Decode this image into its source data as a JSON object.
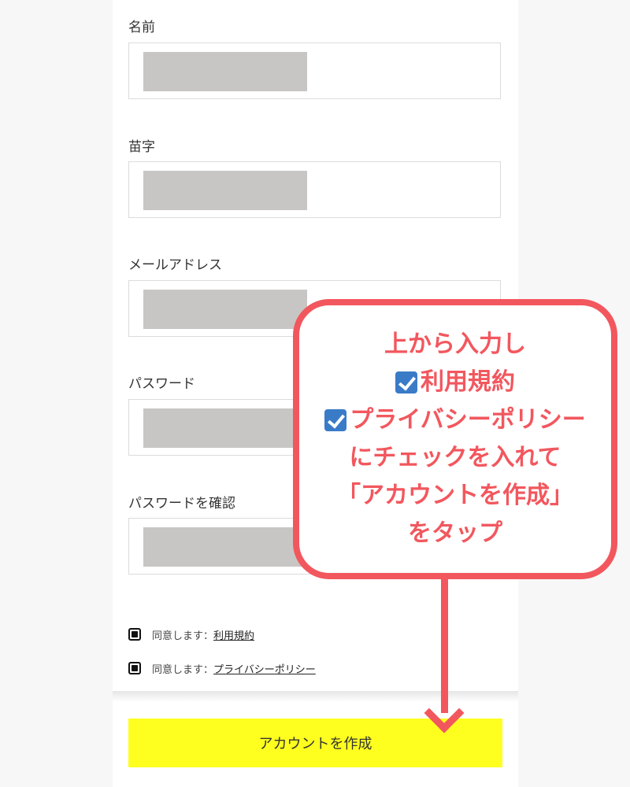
{
  "form": {
    "first_name_label": "名前",
    "last_name_label": "苗字",
    "email_label": "メールアドレス",
    "password_label": "パスワード",
    "confirm_password_label": "パスワードを確認",
    "agree_prefix": "同意します：",
    "terms_link": "利用規約",
    "privacy_link": "プライバシーポリシー",
    "create_button": "アカウントを作成"
  },
  "annotation": {
    "line1": "上から入力し",
    "line2": "利用規約",
    "line3": "プライバシーポリシー",
    "line4": "にチェックを入れて",
    "line5": "「アカウントを作成」",
    "line6": "をタップ"
  },
  "colors": {
    "button": "#ffff1f",
    "annotation": "#f2575e",
    "redaction": "#c8c6c4"
  }
}
